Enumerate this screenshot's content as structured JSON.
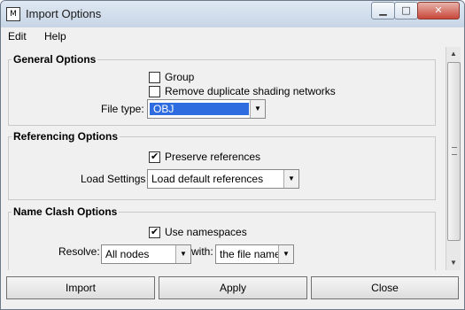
{
  "window": {
    "title": "Import Options",
    "app_icon": "maya-icon"
  },
  "menu": [
    "Edit",
    "Help"
  ],
  "general_options": {
    "title": "General Options",
    "group_label": "Group",
    "group_checked": false,
    "remove_dup_label": "Remove duplicate shading networks",
    "remove_dup_checked": false,
    "file_type_label": "File type:",
    "file_type_value": "OBJ"
  },
  "referencing_options": {
    "title": "Referencing Options",
    "preserve_label": "Preserve references",
    "preserve_checked": true,
    "load_settings_label": "Load Settings",
    "load_settings_value": "Load default references"
  },
  "name_clash_options": {
    "title": "Name Clash Options",
    "use_ns_label": "Use namespaces",
    "use_ns_checked": true,
    "resolve_label": "Resolve:",
    "resolve_value": "All nodes",
    "with_label": "with:",
    "with_value": "the file name"
  },
  "buttons": {
    "import": "Import",
    "apply": "Apply",
    "close": "Close"
  }
}
